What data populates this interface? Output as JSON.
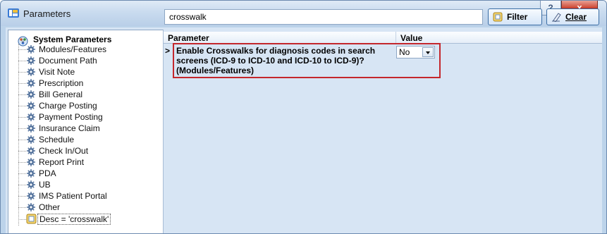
{
  "window": {
    "title": "Parameters",
    "help_label": "?",
    "close_label": "x"
  },
  "tree": {
    "root_label": "System Parameters",
    "items": [
      {
        "label": "Modules/Features"
      },
      {
        "label": "Document Path"
      },
      {
        "label": "Visit Note"
      },
      {
        "label": "Prescription"
      },
      {
        "label": "Bill General"
      },
      {
        "label": "Charge Posting"
      },
      {
        "label": "Payment Posting"
      },
      {
        "label": "Insurance Claim"
      },
      {
        "label": "Schedule"
      },
      {
        "label": "Check In/Out"
      },
      {
        "label": "Report Print"
      },
      {
        "label": "PDA"
      },
      {
        "label": "UB"
      },
      {
        "label": "IMS Patient Portal"
      },
      {
        "label": "Other"
      },
      {
        "label": "Desc = 'crosswalk'"
      }
    ]
  },
  "search": {
    "value": "crosswalk"
  },
  "toolbar": {
    "filter_label": "Filter",
    "clear_label": "Clear"
  },
  "grid": {
    "columns": {
      "parameter": "Parameter",
      "value": "Value"
    },
    "rows": [
      {
        "indicator": ">",
        "parameter": "Enable Crosswalks for diagnosis codes in search screens (ICD-9 to ICD-10 and ICD-10 to ICD-9)? (Modules/Features)",
        "value": "No"
      }
    ]
  },
  "colors": {
    "highlight": "#c4272c",
    "panel_background": "#d7e5f4",
    "title_background": "#c9dbef"
  }
}
